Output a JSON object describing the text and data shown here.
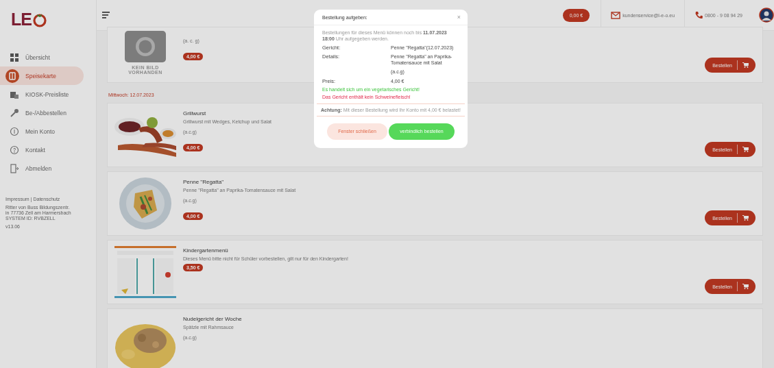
{
  "sidebar": {
    "logo_text": "LE",
    "nav": [
      {
        "label": "Übersicht",
        "selected": false
      },
      {
        "label": "Speisekarte",
        "selected": true
      },
      {
        "label": "KIOSK-Preisliste",
        "selected": false
      },
      {
        "label": "Be-/Abbestellen",
        "selected": false
      },
      {
        "label": "Mein Konto",
        "selected": false
      },
      {
        "label": "Kontakt",
        "selected": false
      },
      {
        "label": "Abmelden",
        "selected": false
      }
    ],
    "footer_links": [
      "Impressum",
      "Datenschutz"
    ],
    "footer_separator": "|",
    "address": [
      "Ritter von Buss Bildungszentr.",
      "in 77736 Zell am Harmersbach",
      "SYSTEM ID: RVBZELL"
    ],
    "version": "v13.06"
  },
  "header": {
    "balance": "0,00 €",
    "email": "kundenservice@l-e-o.eu",
    "phone": "0800 - 9 08 94 29"
  },
  "menu": [
    {
      "kind": "dish",
      "image": {
        "kind": "placeholder",
        "text": "KEIN BILD VORHANDEN"
      },
      "allergens": "(a. c. g)",
      "price": "4,00 €",
      "order_button": "Bestellen"
    },
    {
      "kind": "date",
      "label": "Mittwoch: 12.07.2023"
    },
    {
      "kind": "dish",
      "title": "Grillwurst",
      "description": "Grillwurst mit Wedges, Ketchup und Salat",
      "allergens": "(a.c.g)",
      "price": "4,00 €",
      "order_button": "Bestellen"
    },
    {
      "kind": "dish",
      "title": "Penne \"Regatta\"",
      "description": "Penne \"Regatta\" an Paprika-Tomatensauce mit Salat",
      "allergens": "(a.c.g)",
      "price": "4,00 €",
      "order_button": "Bestellen"
    },
    {
      "kind": "dish",
      "title": "Kindergartenmenü",
      "description": "Dieses Menü bitte nicht für Schüler vorbestellen, gilt nur für den Kindergarten!",
      "price": "3,50 €",
      "order_button": "Bestellen"
    },
    {
      "kind": "dish",
      "title": "Nudelgericht der Woche",
      "description": "Spätzle mit Rahmsauce",
      "allergens": "(a.c.g)"
    }
  ],
  "dialog": {
    "title": "Bestellung aufgeben:",
    "close": "×",
    "notice": "Bestellungen für dieses Menü können noch bis **11.07.2023 18:00** Uhr aufgegeben werden.",
    "rows": [
      {
        "label": "Gericht:",
        "value": "Penne \"Regatta\"(12.07.2023)"
      },
      {
        "label": "Details:",
        "value": "Penne \"Regatta\" an Paprika-Tomatensauce mit Salat"
      },
      {
        "label": "",
        "value": "(a.c.g)"
      },
      {
        "label": "Preis:",
        "value": "4,00 €"
      }
    ],
    "hints": [
      {
        "text": "Es handelt sich um ein vegetarisches Gericht!",
        "kind": "positive"
      },
      {
        "text": "Das Gericht enthält kein Schweinefleisch!",
        "kind": "negative"
      }
    ],
    "warning": "**Achtung:** Mit dieser Bestellung wird Ihr Konto mit 4,00 € belastet!",
    "buttons": [
      {
        "label": "Fenster schließen",
        "kind": "secondary"
      },
      {
        "label": "verbindlich bestellen",
        "kind": "primary"
      }
    ]
  }
}
